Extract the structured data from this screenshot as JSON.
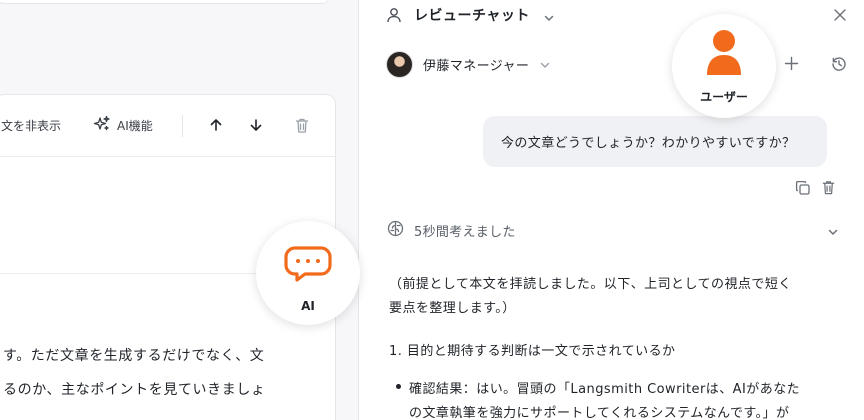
{
  "editor": {
    "toolbar": {
      "hide_text_label": "文を非表示",
      "ai_features_label": "AI機能"
    },
    "body_lines": [
      "す。ただ文章を生成するだけでなく、文",
      "るのか、主なポイントを見ていきましょ"
    ]
  },
  "chat": {
    "header": {
      "title": "レビューチャット"
    },
    "persona": {
      "name": "伊藤マネージャー"
    },
    "user_message": "今の文章どうでしょうか？わかりやすいですか？",
    "thinking_label": "5秒間考えました",
    "answer_lines": [
      "（前提として本文を拝読しました。以下、上司としての視点で短く",
      "要点を整理します。）",
      "1. 目的と期待する判断は一文で示されているか",
      "確認結果：はい。冒頭の「Langsmith Cowriterは、AIがあなた",
      "の文章執筆を強力にサポートしてくれるシステムなんです。」が"
    ]
  },
  "callouts": {
    "user_label": "ユーザー",
    "ai_label": "AI"
  },
  "colors": {
    "accent_orange": "#f26a1b",
    "user_bubble_bg": "#f0f1f4",
    "panel_bg": "#ffffff",
    "page_bg": "#f7f7f9"
  }
}
